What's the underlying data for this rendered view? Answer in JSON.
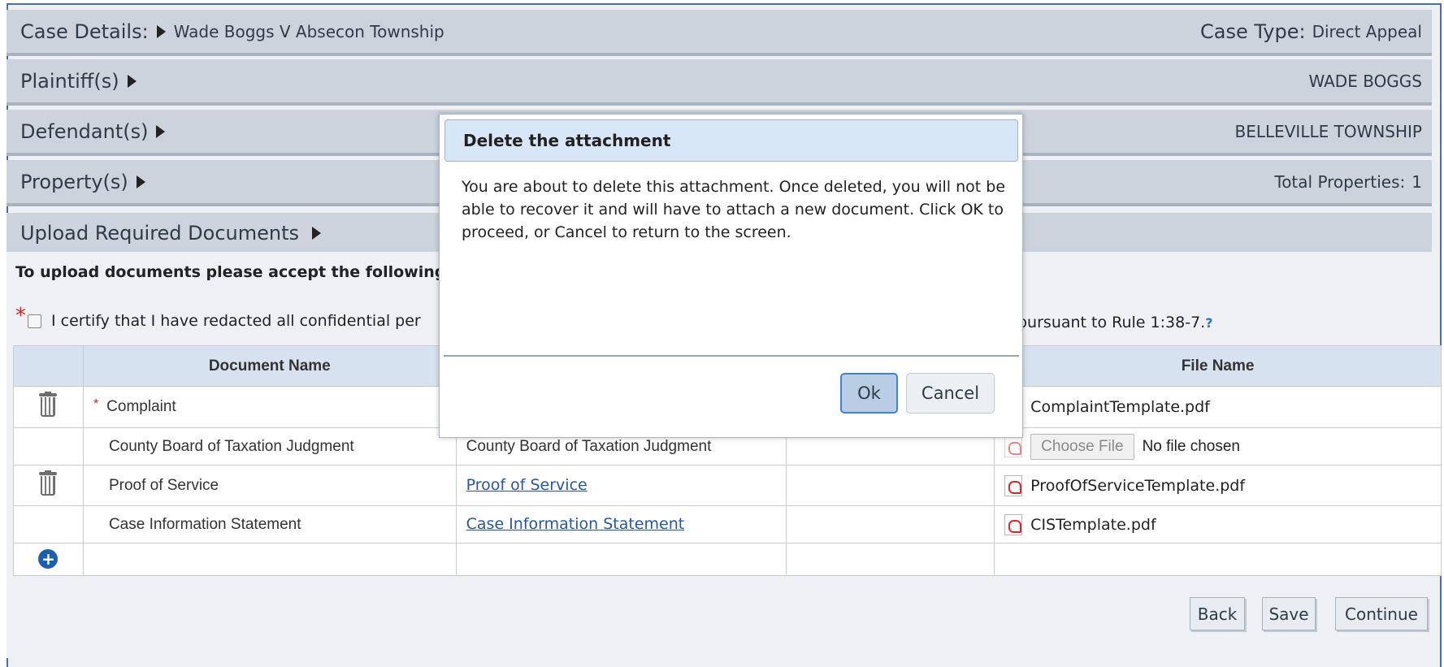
{
  "case_bar": {
    "label": "Case Details:",
    "value": "Wade Boggs V Absecon Township",
    "type_label": "Case Type:",
    "type_value": "Direct Appeal"
  },
  "plaintiff_bar": {
    "label": "Plaintiff(s)",
    "value": "WADE BOGGS"
  },
  "defendant_bar": {
    "label": "Defendant(s)",
    "value": "BELLEVILLE TOWNSHIP"
  },
  "property_bar": {
    "label": "Property(s)",
    "value_label": "Total Properties:",
    "value": "1"
  },
  "upload_bar": {
    "label": "Upload Required Documents"
  },
  "accept_text": "To upload documents please accept the following:",
  "certify_text_start": "I certify that I have redacted all confidential per",
  "certify_text_end": "pursuant to Rule 1:38-7.",
  "help_icon": "?",
  "table": {
    "headers": {
      "document_name": "Document Name",
      "file_name": "File Name"
    },
    "rows": [
      {
        "name": "Complaint",
        "required": "*",
        "template": "",
        "file": "ComplaintTemplate.pdf"
      },
      {
        "name": "County Board of Taxation Judgment",
        "template": "County Board of Taxation Judgment",
        "choose_label": "Choose File",
        "file": "No file chosen"
      },
      {
        "name": "Proof of Service",
        "template": "Proof of Service",
        "file": "ProofOfServiceTemplate.pdf"
      },
      {
        "name": "Case Information Statement",
        "template": "Case Information Statement",
        "file": "CISTemplate.pdf"
      }
    ]
  },
  "buttons": {
    "back": "Back",
    "save": "Save",
    "continue": "Continue"
  },
  "dialog": {
    "title": "Delete the attachment",
    "body": "You are about to delete this attachment. Once deleted, you will not be able to recover it and will have to attach a new document. Click OK to proceed, or Cancel to return to the screen.",
    "ok": "Ok",
    "cancel": "Cancel"
  },
  "colors": {
    "bar_bg": "#ccd3dc",
    "header_bg": "#d6e2ef",
    "link": "#2756a8",
    "required": "#e02020",
    "dialog_title_bg": "#d8e7f8",
    "ok_border": "#3f83d8"
  }
}
